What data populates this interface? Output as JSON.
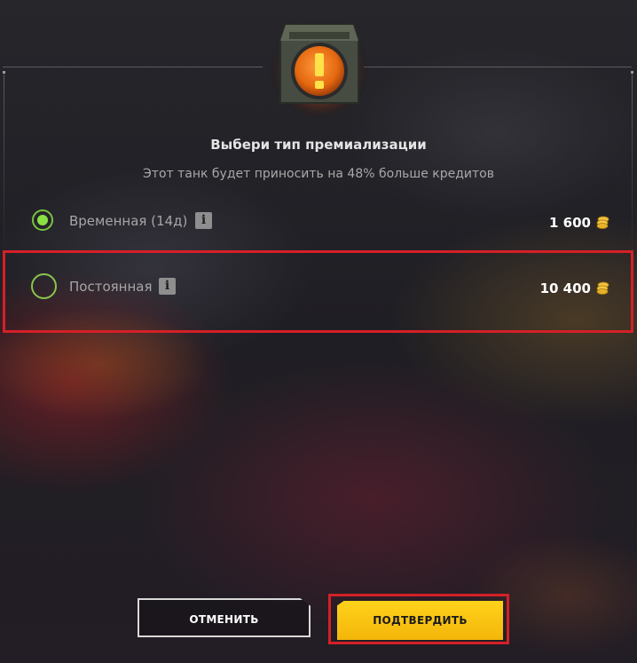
{
  "dialog": {
    "title": "Выбери тип премиализации",
    "subtitle": "Этот танк будет приносить на 48% больше кредитов"
  },
  "options": [
    {
      "label": "Временная (14д)",
      "price": "1 600",
      "selected": true,
      "currency_icon": "gold-coins-icon",
      "info_icon": "info-icon"
    },
    {
      "label": "Постоянная",
      "price": "10 400",
      "selected": false,
      "currency_icon": "gold-coins-icon",
      "info_icon": "info-icon"
    }
  ],
  "buttons": {
    "cancel": "ОТМЕНИТЬ",
    "confirm": "ПОДТВЕРДИТЬ"
  },
  "colors": {
    "accent_green": "#8ae043",
    "confirm_yellow": "#ffd21a",
    "highlight_red": "#d42027",
    "warning_orange": "#f08a1c"
  },
  "icons": {
    "header": "warning-exclamation-icon"
  }
}
